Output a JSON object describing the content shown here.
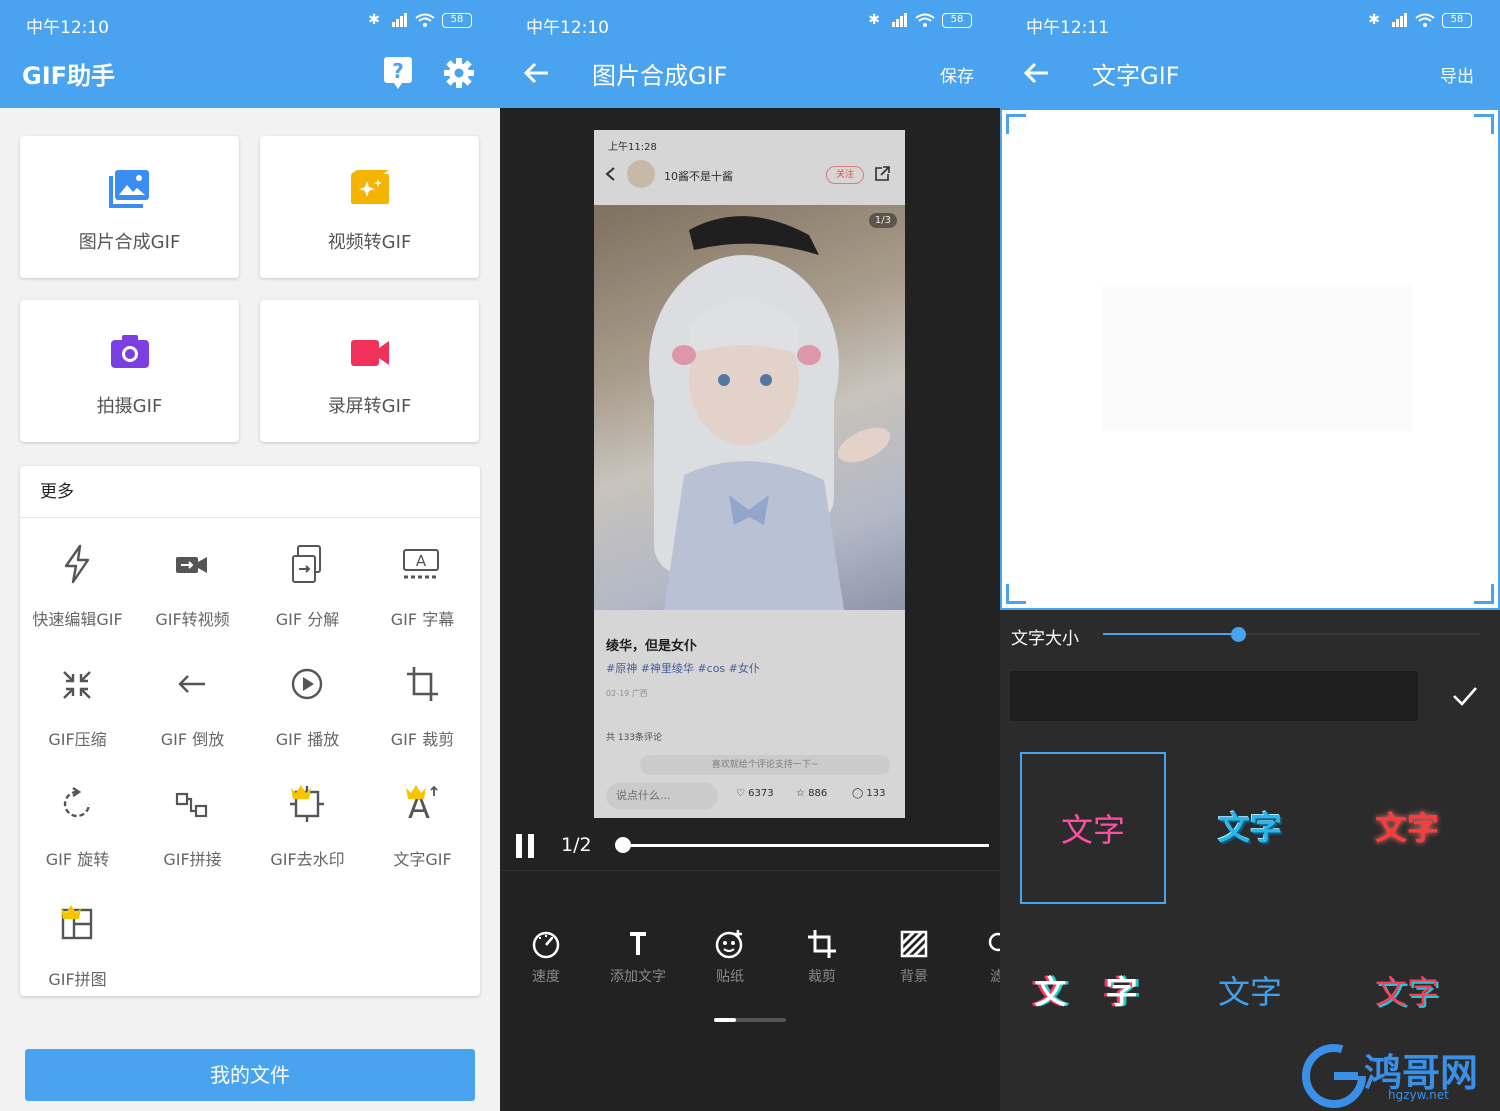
{
  "panel1": {
    "status_time": "中午12:10",
    "battery": "58",
    "title": "GIF助手",
    "cards": [
      {
        "label": "图片合成GIF",
        "icon": "image-icon",
        "color": "#3b8ef0"
      },
      {
        "label": "视频转GIF",
        "icon": "video-clip-icon",
        "color": "#f5b400"
      },
      {
        "label": "拍摄GIF",
        "icon": "camera-icon",
        "color": "#7a3fe0"
      },
      {
        "label": "录屏转GIF",
        "icon": "video-camera-icon",
        "color": "#f0325a"
      }
    ],
    "more_header": "更多",
    "tools": [
      {
        "label": "快速编辑GIF",
        "icon": "lightning-icon",
        "vip": false
      },
      {
        "label": "GIF转视频",
        "icon": "video-convert-icon",
        "vip": false
      },
      {
        "label": "GIF 分解",
        "icon": "split-icon",
        "vip": false
      },
      {
        "label": "GIF 字幕",
        "icon": "subtitle-icon",
        "vip": false
      },
      {
        "label": "GIF压缩",
        "icon": "compress-icon",
        "vip": false
      },
      {
        "label": "GIF 倒放",
        "icon": "reverse-arrow-icon",
        "vip": false
      },
      {
        "label": "GIF 播放",
        "icon": "play-circle-icon",
        "vip": false
      },
      {
        "label": "GIF 裁剪",
        "icon": "crop-icon",
        "vip": false
      },
      {
        "label": "GIF 旋转",
        "icon": "rotate-icon",
        "vip": false
      },
      {
        "label": "GIF拼接",
        "icon": "join-icon",
        "vip": false
      },
      {
        "label": "GIF去水印",
        "icon": "remove-watermark-icon",
        "vip": true
      },
      {
        "label": "文字GIF",
        "icon": "text-icon",
        "vip": true
      },
      {
        "label": "GIF拼图",
        "icon": "collage-icon",
        "vip": true
      }
    ],
    "my_files": "我的文件"
  },
  "panel2": {
    "status_time": "中午12:10",
    "battery": "58",
    "title": "图片合成GIF",
    "action": "保存",
    "preview": {
      "status_time": "上午11:28",
      "user": "10酱不是十酱",
      "follow": "关注",
      "image_count": "1/3",
      "post_title": "绫华，但是女仆",
      "tags": "#原神 #神里绫华 #cos #女仆",
      "date": "02-19 广西",
      "comments": "共 133条评论",
      "comment_hint": "喜欢就给个评论支持一下~",
      "say": "说点什么...",
      "likes": "6373",
      "stars": "886",
      "comment_count": "133"
    },
    "frame": "1/2",
    "progress": 0,
    "tools": [
      {
        "label": "速度",
        "icon": "speed-icon"
      },
      {
        "label": "添加文字",
        "icon": "text-t-icon"
      },
      {
        "label": "贴纸",
        "icon": "sticker-icon"
      },
      {
        "label": "裁剪",
        "icon": "crop-icon"
      },
      {
        "label": "背景",
        "icon": "background-icon"
      },
      {
        "label": "滤",
        "icon": "filter-icon"
      }
    ]
  },
  "panel3": {
    "status_time": "中午12:11",
    "battery": "58",
    "title": "文字GIF",
    "action": "导出",
    "size_label": "文字大小",
    "size_value": 0.36,
    "input_value": "",
    "styles": [
      {
        "text": "文字",
        "color": "#ff4fa3",
        "selected": true
      },
      {
        "text": "文字",
        "color": "#2bb5e8",
        "selected": false
      },
      {
        "text": "文字",
        "color": "#ff3b3b",
        "selected": false
      },
      {
        "text": "文 字",
        "color": "#ffffff",
        "selected": false
      },
      {
        "text": "文字",
        "color": "#3fa0ee",
        "selected": false
      },
      {
        "text": "文字",
        "color": "#ff3d5a",
        "selected": false
      }
    ]
  },
  "watermark": {
    "name": "鸿哥网",
    "url": "hgzyw.net"
  }
}
